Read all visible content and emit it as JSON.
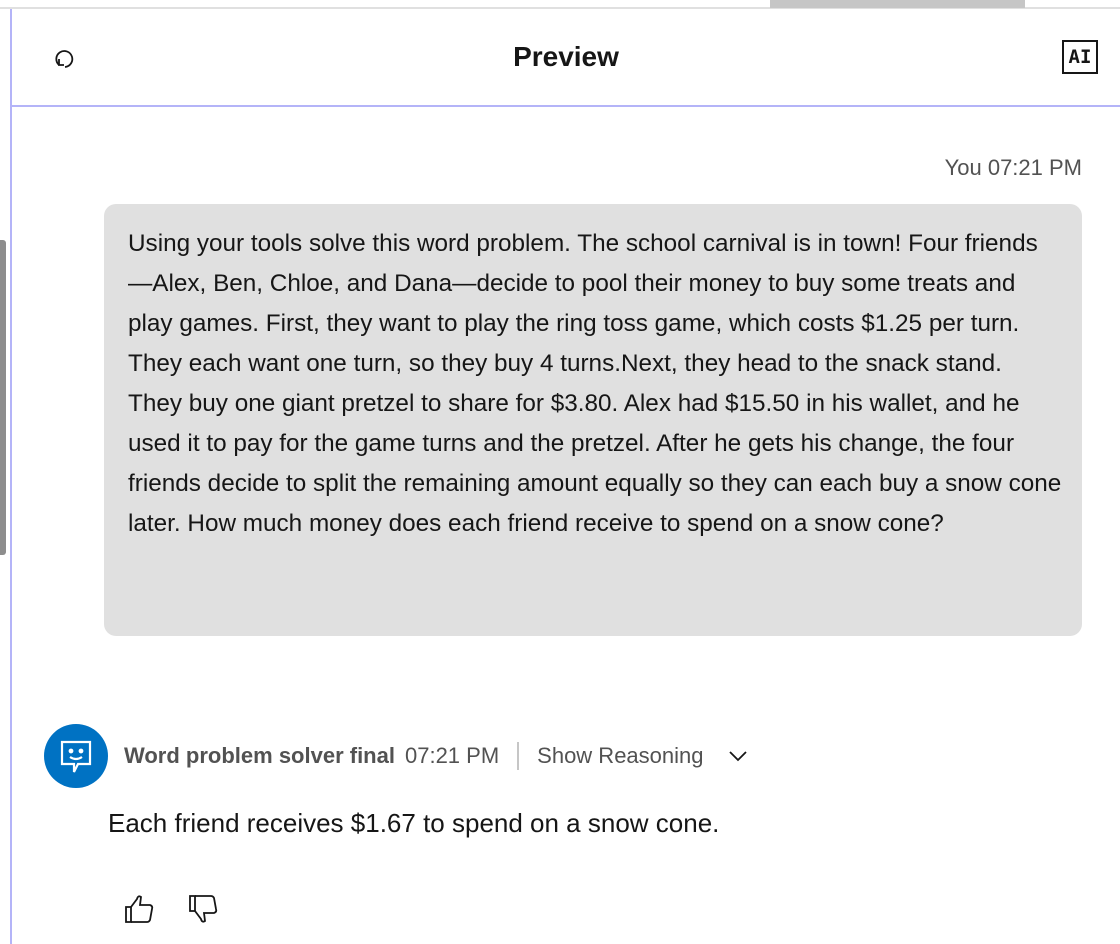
{
  "header": {
    "title": "Preview",
    "ai_badge": "AI",
    "reset_icon": "reset-icon"
  },
  "user_message": {
    "sender": "You",
    "time": "07:21 PM",
    "text": "Using your tools solve this word problem. The school carnival is in town! Four friends—Alex, Ben, Chloe, and Dana—decide to pool their money to buy some treats and play games. First, they want to play the ring toss game, which costs $1.25 per turn. They each want one turn, so they buy 4 turns.Next, they head to the snack stand. They buy one giant pretzel to share for $3.80. Alex had $15.50 in his wallet, and he used it to pay for the game turns and the pretzel. After he gets his change, the four friends decide to split the remaining amount equally so they can each buy a snow cone later. How much money does each friend receive to spend on a snow cone?"
  },
  "bot_message": {
    "name": "Word problem solver final",
    "time": "07:21 PM",
    "show_reasoning": "Show Reasoning",
    "text": "Each friend receives $1.67 to spend on a snow cone.",
    "avatar_color": "#0072c3"
  },
  "feedback": {
    "like_icon": "thumbs-up-icon",
    "dislike_icon": "thumbs-down-icon"
  }
}
